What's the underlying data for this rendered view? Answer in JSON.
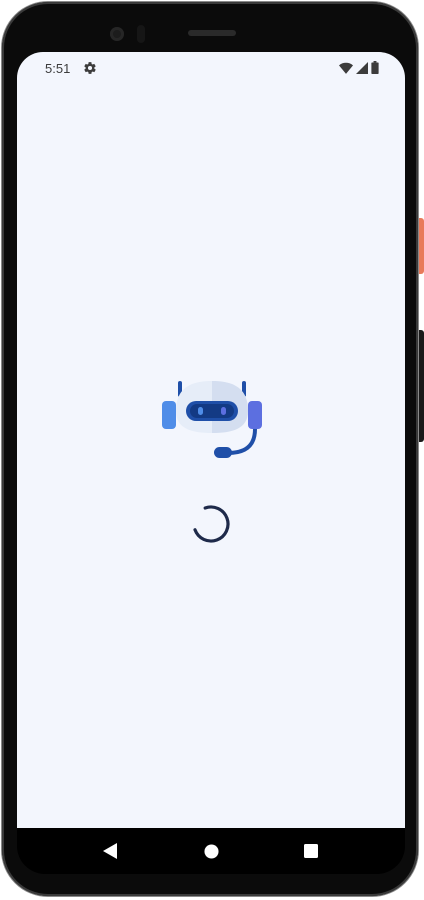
{
  "status_bar": {
    "time": "5:51",
    "icons": [
      "gear-icon",
      "wifi-icon",
      "signal-icon",
      "battery-icon"
    ]
  },
  "splash": {
    "logo_icon": "robot-headset-icon",
    "loading_indicator": "spinner"
  },
  "navigation_bar": {
    "buttons": [
      "back-icon",
      "home-icon",
      "recents-icon"
    ]
  },
  "colors": {
    "screen_background": "#f3f6fd",
    "robot_primary": "#1f4fa8",
    "robot_accent": "#4f8de8",
    "spinner": "#1e2a4a",
    "device_frame": "#0b0b0b",
    "power_button": "#e87a5a"
  }
}
